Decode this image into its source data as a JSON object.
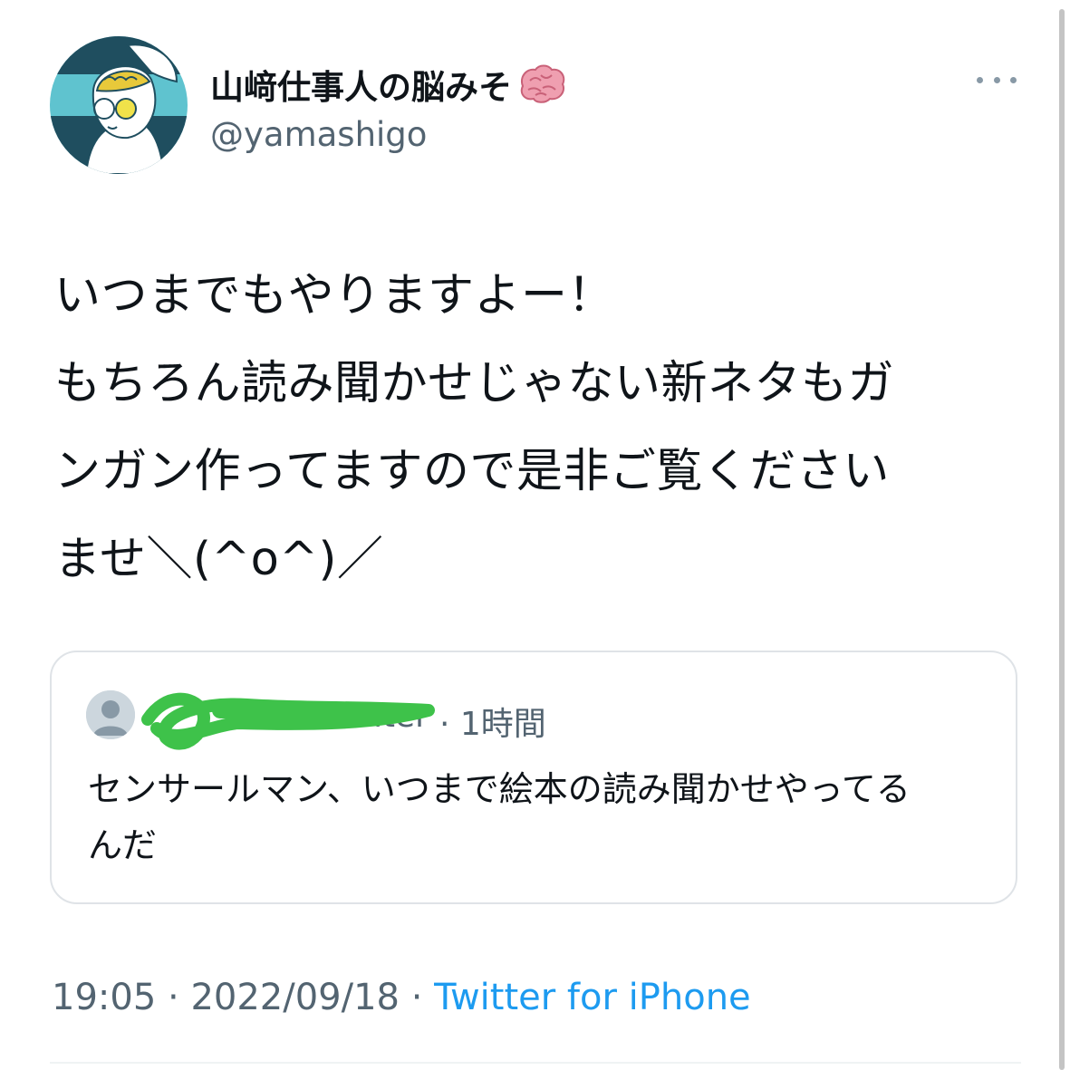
{
  "author": {
    "display_name": "山﨑仕事人の脳みそ",
    "handle": "@yamashigo",
    "name_emoji_icon": "brain-icon"
  },
  "tweet": {
    "lines": [
      "いつまでもやりますよー！",
      "もちろん読み聞かせじゃない新ネタもガ",
      "ンガン作ってますので是非ご覧ください",
      "ませ＼(^o^)／"
    ]
  },
  "quote": {
    "author_visible": "inter",
    "time": "· 1時間",
    "lines": [
      "センサールマン、いつまで絵本の読み聞かせやってる",
      "んだ"
    ]
  },
  "meta": {
    "time": "19:05",
    "sep1": " · ",
    "date": "2022/09/18",
    "sep2": " · ",
    "source": "Twitter for iPhone"
  },
  "colors": {
    "text": "#0f1419",
    "secondary": "#536471",
    "link": "#1d9bf0",
    "border": "#dfe3e7",
    "redaction": "#3ec24a",
    "avatar_teal": "#1f4e5f",
    "avatar_cyan": "#5fc3cf",
    "brain_pink": "#e8879a"
  }
}
